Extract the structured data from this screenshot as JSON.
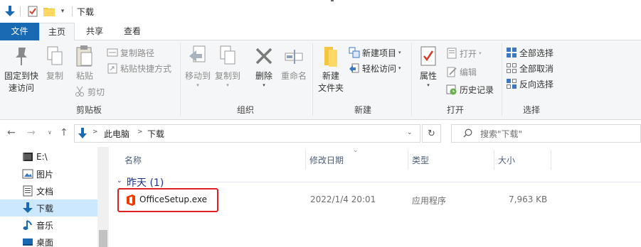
{
  "window": {
    "title": "下载"
  },
  "ribbon_tabs": [
    {
      "label": "文件"
    },
    {
      "label": "主页"
    },
    {
      "label": "共享"
    },
    {
      "label": "查看"
    }
  ],
  "clipboard": {
    "group_label": "剪贴板",
    "pin_label_line1": "固定到快",
    "pin_label_line2": "速访问",
    "copy_label": "复制",
    "paste_label": "粘贴",
    "copy_path_label": "复制路径",
    "paste_shortcut_label": "粘贴快捷方式",
    "cut_label": "剪切"
  },
  "organize": {
    "group_label": "组织",
    "move_to_label": "移动到",
    "copy_to_label": "复制到",
    "delete_label": "删除",
    "rename_label": "重命名"
  },
  "new": {
    "group_label": "新建",
    "new_folder_line1": "新建",
    "new_folder_line2": "文件夹",
    "new_item_label": "新建项目",
    "easy_access_label": "轻松访问"
  },
  "open": {
    "group_label": "打开",
    "properties_label": "属性",
    "open_label": "打开",
    "edit_label": "编辑",
    "history_label": "历史记录"
  },
  "select": {
    "group_label": "选择",
    "select_all_label": "全部选择",
    "select_none_label": "全部取消",
    "invert_label": "反向选择"
  },
  "address": {
    "path": [
      "此电脑",
      "下载"
    ],
    "separator": ">",
    "search_placeholder": "搜索\"下载\""
  },
  "nav_pane": {
    "items": [
      {
        "label": "E:\\",
        "icon": "drive-icon"
      },
      {
        "label": "图片",
        "icon": "pictures-icon"
      },
      {
        "label": "文档",
        "icon": "documents-icon"
      },
      {
        "label": "下载",
        "icon": "downloads-icon",
        "selected": true
      },
      {
        "label": "音乐",
        "icon": "music-icon"
      },
      {
        "label": "桌面",
        "icon": "desktop-icon"
      }
    ]
  },
  "columns": [
    {
      "label": "名称"
    },
    {
      "label": "修改日期"
    },
    {
      "label": "类型"
    },
    {
      "label": "大小"
    }
  ],
  "group": {
    "label": "昨天 (1)"
  },
  "files": [
    {
      "name": "OfficeSetup.exe",
      "modified": "2022/1/4 20:01",
      "type": "应用程序",
      "size": "7,963 KB",
      "icon": "office-icon"
    }
  ],
  "colors": {
    "accent": "#1a6ab3",
    "selection": "#cce8ff",
    "highlight_border": "#e02020",
    "office_orange": "#eb3c00"
  }
}
